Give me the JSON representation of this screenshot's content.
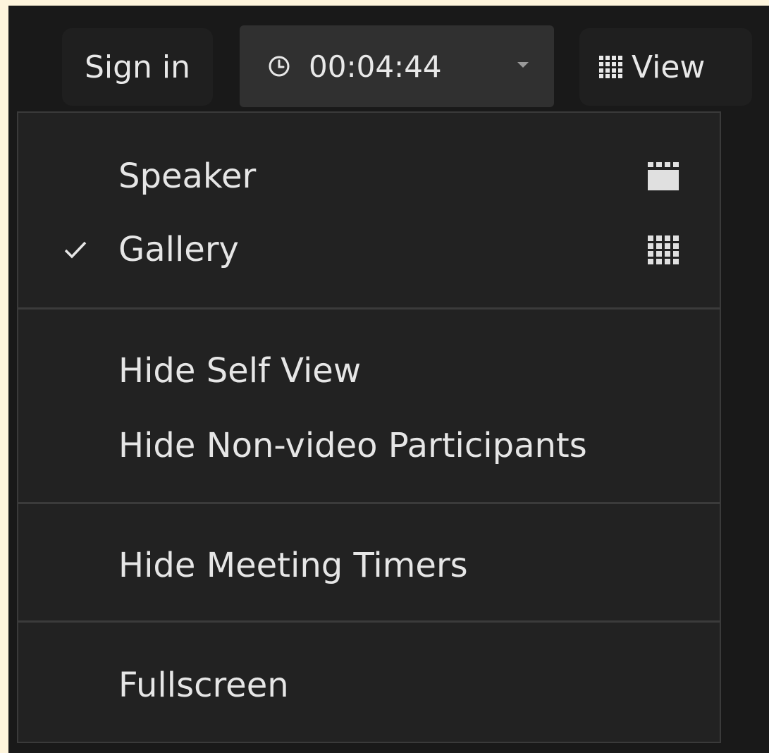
{
  "toolbar": {
    "sign_in_label": "Sign in",
    "timer_value": "00:04:44",
    "view_label": "View"
  },
  "view_menu": {
    "layout_items": [
      {
        "label": "Speaker",
        "checked": false,
        "icon": "speaker-view-icon"
      },
      {
        "label": "Gallery",
        "checked": true,
        "icon": "gallery-view-icon"
      }
    ],
    "visibility_items": [
      {
        "label": "Hide Self View"
      },
      {
        "label": "Hide Non-video Participants"
      }
    ],
    "timer_items": [
      {
        "label": "Hide Meeting Timers"
      }
    ],
    "screen_items": [
      {
        "label": "Fullscreen"
      }
    ]
  },
  "colors": {
    "background": "#191919",
    "menu_background": "#222222",
    "text": "#e6e6e6",
    "frame": "#fef5dc"
  }
}
